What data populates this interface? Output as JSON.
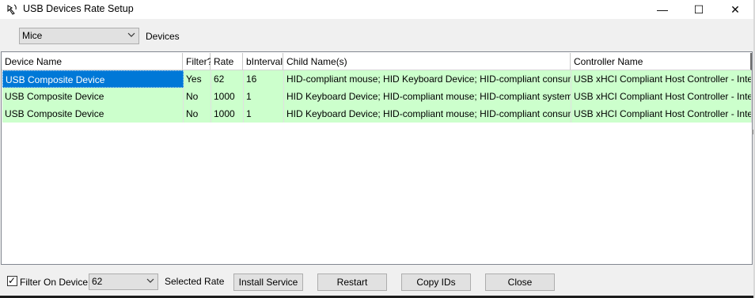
{
  "window": {
    "title": "USB Devices Rate Setup",
    "min_glyph": "—",
    "max_glyph": "☐",
    "close_glyph": "✕"
  },
  "filter": {
    "type_value": "Mice",
    "type_label": "Devices"
  },
  "table": {
    "columns": [
      "Device Name",
      "Filter?",
      "Rate",
      "bInterval",
      "Child Name(s)",
      "Controller Name"
    ],
    "rows": [
      [
        "USB Composite Device",
        "Yes",
        "62",
        "16",
        "HID-compliant mouse; HID Keyboard Device; HID-compliant consumer contr",
        "USB xHCI Compliant Host Controller - Intel(R) USB"
      ],
      [
        "USB Composite Device",
        "No",
        "1000",
        "1",
        "HID Keyboard Device; HID-compliant mouse; HID-compliant system controller",
        "USB xHCI Compliant Host Controller - Intel(R) USB"
      ],
      [
        "USB Composite Device",
        "No",
        "1000",
        "1",
        "HID Keyboard Device; HID-compliant mouse; HID-compliant consumer contr",
        "USB xHCI Compliant Host Controller - Intel(R) USB"
      ]
    ],
    "selected_row": 0,
    "row_color": "#ccffcc",
    "selection_color": "#0078d7"
  },
  "bottom": {
    "filter_checked": true,
    "check_glyph": "✓",
    "filter_label": "Filter On Device",
    "rate_value": "62",
    "rate_label": "Selected Rate",
    "install_label": "Install Service",
    "restart_label": "Restart",
    "copy_label": "Copy IDs",
    "close_label": "Close"
  }
}
